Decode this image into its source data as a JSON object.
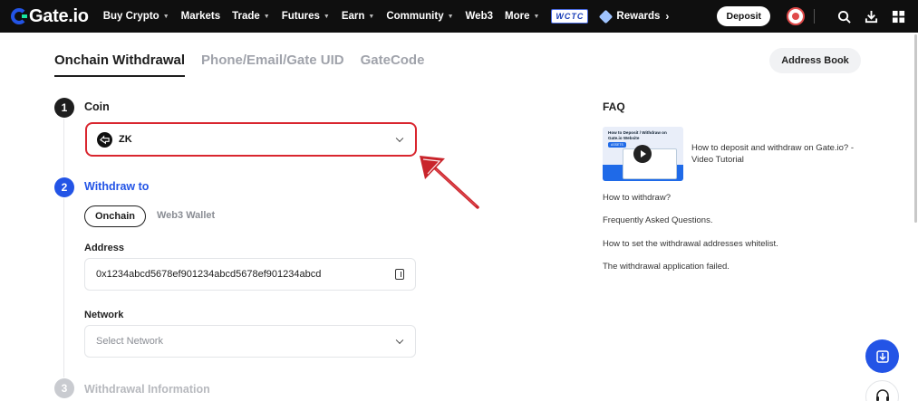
{
  "nav": {
    "logo": "Gate.io",
    "items": [
      {
        "label": "Buy Crypto",
        "caret": true
      },
      {
        "label": "Markets",
        "caret": false
      },
      {
        "label": "Trade",
        "caret": true
      },
      {
        "label": "Futures",
        "caret": true
      },
      {
        "label": "Earn",
        "caret": true
      },
      {
        "label": "Community",
        "caret": true
      },
      {
        "label": "Web3",
        "caret": false
      },
      {
        "label": "More",
        "caret": true
      }
    ],
    "wctc_badge": "WCTC",
    "rewards_label": "Rewards",
    "deposit_label": "Deposit"
  },
  "tabs": {
    "onchain": "Onchain Withdrawal",
    "phone": "Phone/Email/Gate UID",
    "gatecode": "GateCode"
  },
  "address_book_label": "Address Book",
  "steps": {
    "step1": {
      "num": "1",
      "label": "Coin"
    },
    "step2": {
      "num": "2",
      "label": "Withdraw to"
    },
    "step3": {
      "num": "3",
      "label": "Withdrawal Information"
    }
  },
  "coin": {
    "symbol": "ZK"
  },
  "withdraw_to": {
    "onchain": "Onchain",
    "web3": "Web3 Wallet"
  },
  "address": {
    "label": "Address",
    "value": "0x1234abcd5678ef901234abcd5678ef901234abcd"
  },
  "network": {
    "label": "Network",
    "placeholder": "Select Network"
  },
  "faq": {
    "title": "FAQ",
    "thumb_title": "How to Deposit / Withdraw on Gate.io Website",
    "thumb_badge": "ASSETS",
    "video_title": "How to deposit and withdraw on Gate.io? -Video Tutorial",
    "links": [
      "How to withdraw?",
      "Frequently Asked Questions.",
      "How to set the withdrawal addresses whitelist.",
      "The withdrawal application failed."
    ]
  },
  "colors": {
    "nav_bg": "#0f0f0f",
    "brand_blue": "#2354e6",
    "highlight_red": "#d9262f",
    "step_done": "#1e1e1e",
    "step_disabled": "#c9cbd0"
  }
}
